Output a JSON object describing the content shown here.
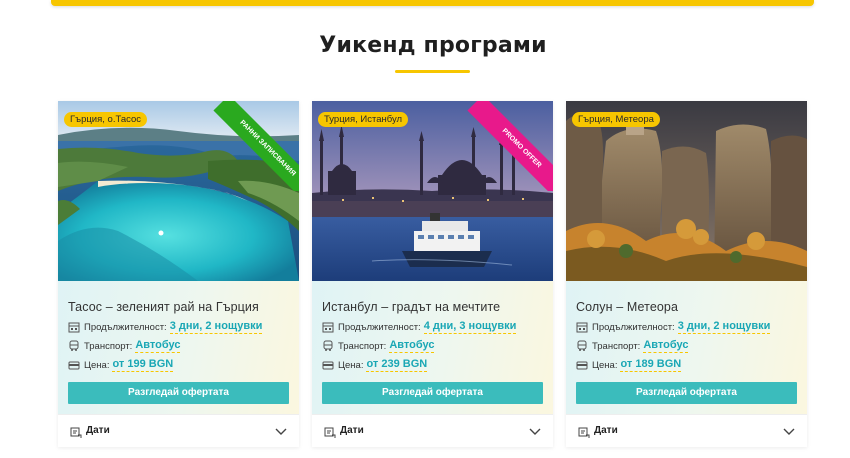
{
  "section": {
    "title": "Уикенд програми"
  },
  "colors": {
    "accent": "#f7c600",
    "teal": "#3bbcbc",
    "green_ribbon": "#2aa91f",
    "pink_ribbon": "#e8198b"
  },
  "labels": {
    "duration": "Продължителност:",
    "transport": "Транспорт:",
    "price": "Цена:",
    "button": "Разгледай офертата",
    "dates": "Дати"
  },
  "cards": [
    {
      "tag": "Гърция, о.Тасос",
      "ribbon": "РАННИ ЗАПИСВАНИЯ",
      "title": "Тасос – зеленият рай на Гърция",
      "duration": "3 дни, 2 нощувки",
      "transport": "Автобус",
      "price": "от 199 BGN"
    },
    {
      "tag": "Турция, Истанбул",
      "ribbon": "PROMO OFFER",
      "title": "Истанбул – градът на мечтите",
      "duration": "4 дни, 3 нощувки",
      "transport": "Автобус",
      "price": "от 239 BGN"
    },
    {
      "tag": "Гърция, Метеора",
      "ribbon": "",
      "title": "Солун – Метеора",
      "duration": "3 дни, 2 нощувки",
      "transport": "Автобус",
      "price": "от 189 BGN"
    }
  ],
  "icons": {
    "duration": "calendar-icon",
    "transport": "bus-icon",
    "price": "wallet-icon",
    "dates": "calendar-list-icon",
    "expand": "chevron-down-icon"
  }
}
